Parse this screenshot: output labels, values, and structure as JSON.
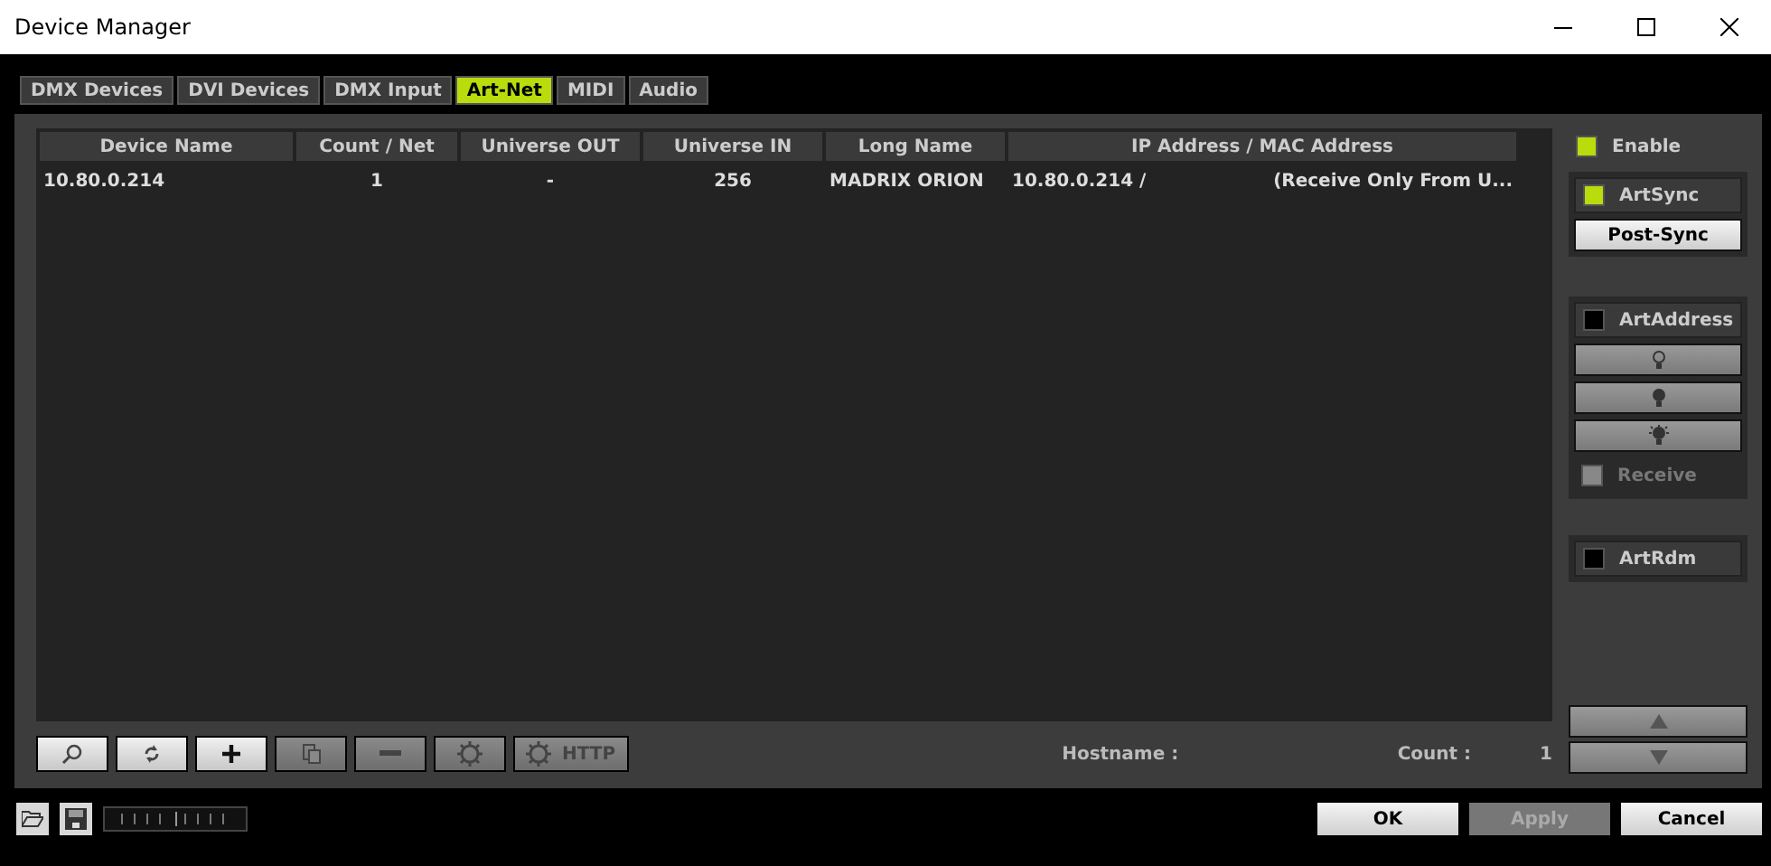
{
  "window": {
    "title": "Device Manager"
  },
  "tabs": [
    {
      "label": "DMX Devices",
      "selected": false
    },
    {
      "label": "DVI Devices",
      "selected": false
    },
    {
      "label": "DMX Input",
      "selected": false
    },
    {
      "label": "Art-Net",
      "selected": true
    },
    {
      "label": "MIDI",
      "selected": false
    },
    {
      "label": "Audio",
      "selected": false
    }
  ],
  "table": {
    "columns": [
      "Device Name",
      "Count / Net",
      "Universe OUT",
      "Universe IN",
      "Long Name",
      "IP Address / MAC Address"
    ],
    "rows": [
      {
        "cells": [
          "10.80.0.214",
          "1",
          "-",
          "256",
          "MADRIX ORION",
          "10.80.0.214 /"
        ],
        "note": "(Receive Only From U..."
      }
    ]
  },
  "toolbar": [
    {
      "kind": "search",
      "disabled": false
    },
    {
      "kind": "refresh",
      "disabled": false
    },
    {
      "kind": "add",
      "disabled": false
    },
    {
      "kind": "copy",
      "disabled": true
    },
    {
      "kind": "remove",
      "disabled": true
    },
    {
      "kind": "gear",
      "disabled": true
    },
    {
      "kind": "http",
      "label": "HTTP",
      "disabled": true
    }
  ],
  "hostname_label": "Hostname :",
  "count_label": "Count :",
  "count_value": "1",
  "enable": {
    "label": "Enable",
    "checked": true
  },
  "artsync": {
    "label": "ArtSync",
    "checked": true,
    "button": "Post-Sync"
  },
  "artaddress": {
    "label": "ArtAddress",
    "checked": false,
    "buttons": [
      {
        "kind": "bulb-off"
      },
      {
        "kind": "bulb-on"
      },
      {
        "kind": "bulb-flash"
      }
    ],
    "receive": {
      "label": "Receive",
      "checked": false,
      "disabled": true
    }
  },
  "artrdm": {
    "label": "ArtRdm",
    "checked": false
  },
  "zoom_slider": {
    "level": 0.5
  },
  "move_buttons": [
    {
      "kind": "up"
    },
    {
      "kind": "down"
    }
  ],
  "footer_buttons": [
    {
      "label": "OK",
      "disabled": false
    },
    {
      "label": "Apply",
      "disabled": true
    },
    {
      "label": "Cancel",
      "disabled": false
    }
  ]
}
